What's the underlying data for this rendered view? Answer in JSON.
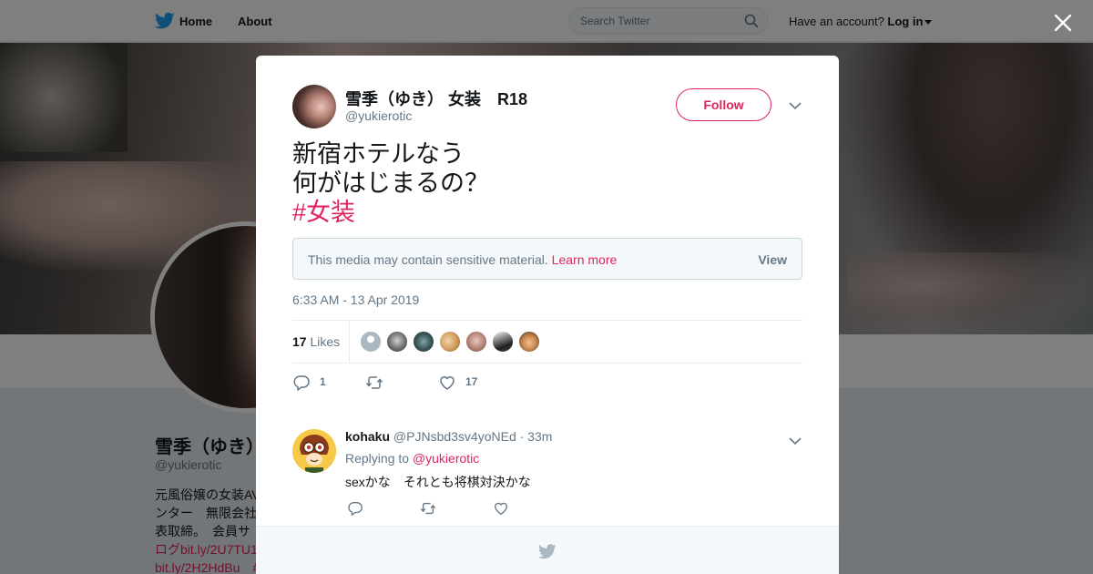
{
  "colors": {
    "accent": "#e0245e",
    "twitter_blue": "#1da1f2",
    "muted": "#657786",
    "text": "#14171a"
  },
  "nav": {
    "home": "Home",
    "about": "About",
    "search_placeholder": "Search Twitter",
    "have_account": "Have an account?",
    "login": "Log in",
    "icons": [
      "twitter-bird-icon",
      "search-icon",
      "caret-down-icon",
      "close-icon"
    ]
  },
  "profile": {
    "name": "雪季（ゆき）",
    "handle": "@yukierotic",
    "bio_lines": [
      "元風俗嬢の女装AV",
      "ンター　無限会社",
      "表取締。　会員サ",
      "ログbit.ly/2U7TU1",
      "bit.ly/2H2HdBu　#"
    ]
  },
  "tweet": {
    "name": "雪季（ゆき） 女装　R18",
    "handle": "@yukierotic",
    "follow": "Follow",
    "text_lines": [
      "新宿ホテルなう",
      "何がはじまるの？"
    ],
    "hashtag": "#女装",
    "sensitive_msg": "This media may contain sensitive material.",
    "learn_more": "Learn more",
    "view": "View",
    "time": "6:33 AM - 13 Apr 2019",
    "likes_count": "17",
    "likes_label": "Likes",
    "reply_count": "1",
    "like_action_count": "17",
    "liker_avatars": [
      "default-avatar",
      "avatar-2",
      "avatar-3",
      "avatar-4",
      "avatar-5",
      "avatar-6",
      "avatar-7"
    ]
  },
  "reply": {
    "name": "kohaku",
    "handle": "@PJNsbd3sv4yoNEd",
    "time": "· 33m",
    "replying_to_label": "Replying to",
    "replying_to": "@yukierotic",
    "text": "sexかな　それとも将棋対決かな"
  }
}
